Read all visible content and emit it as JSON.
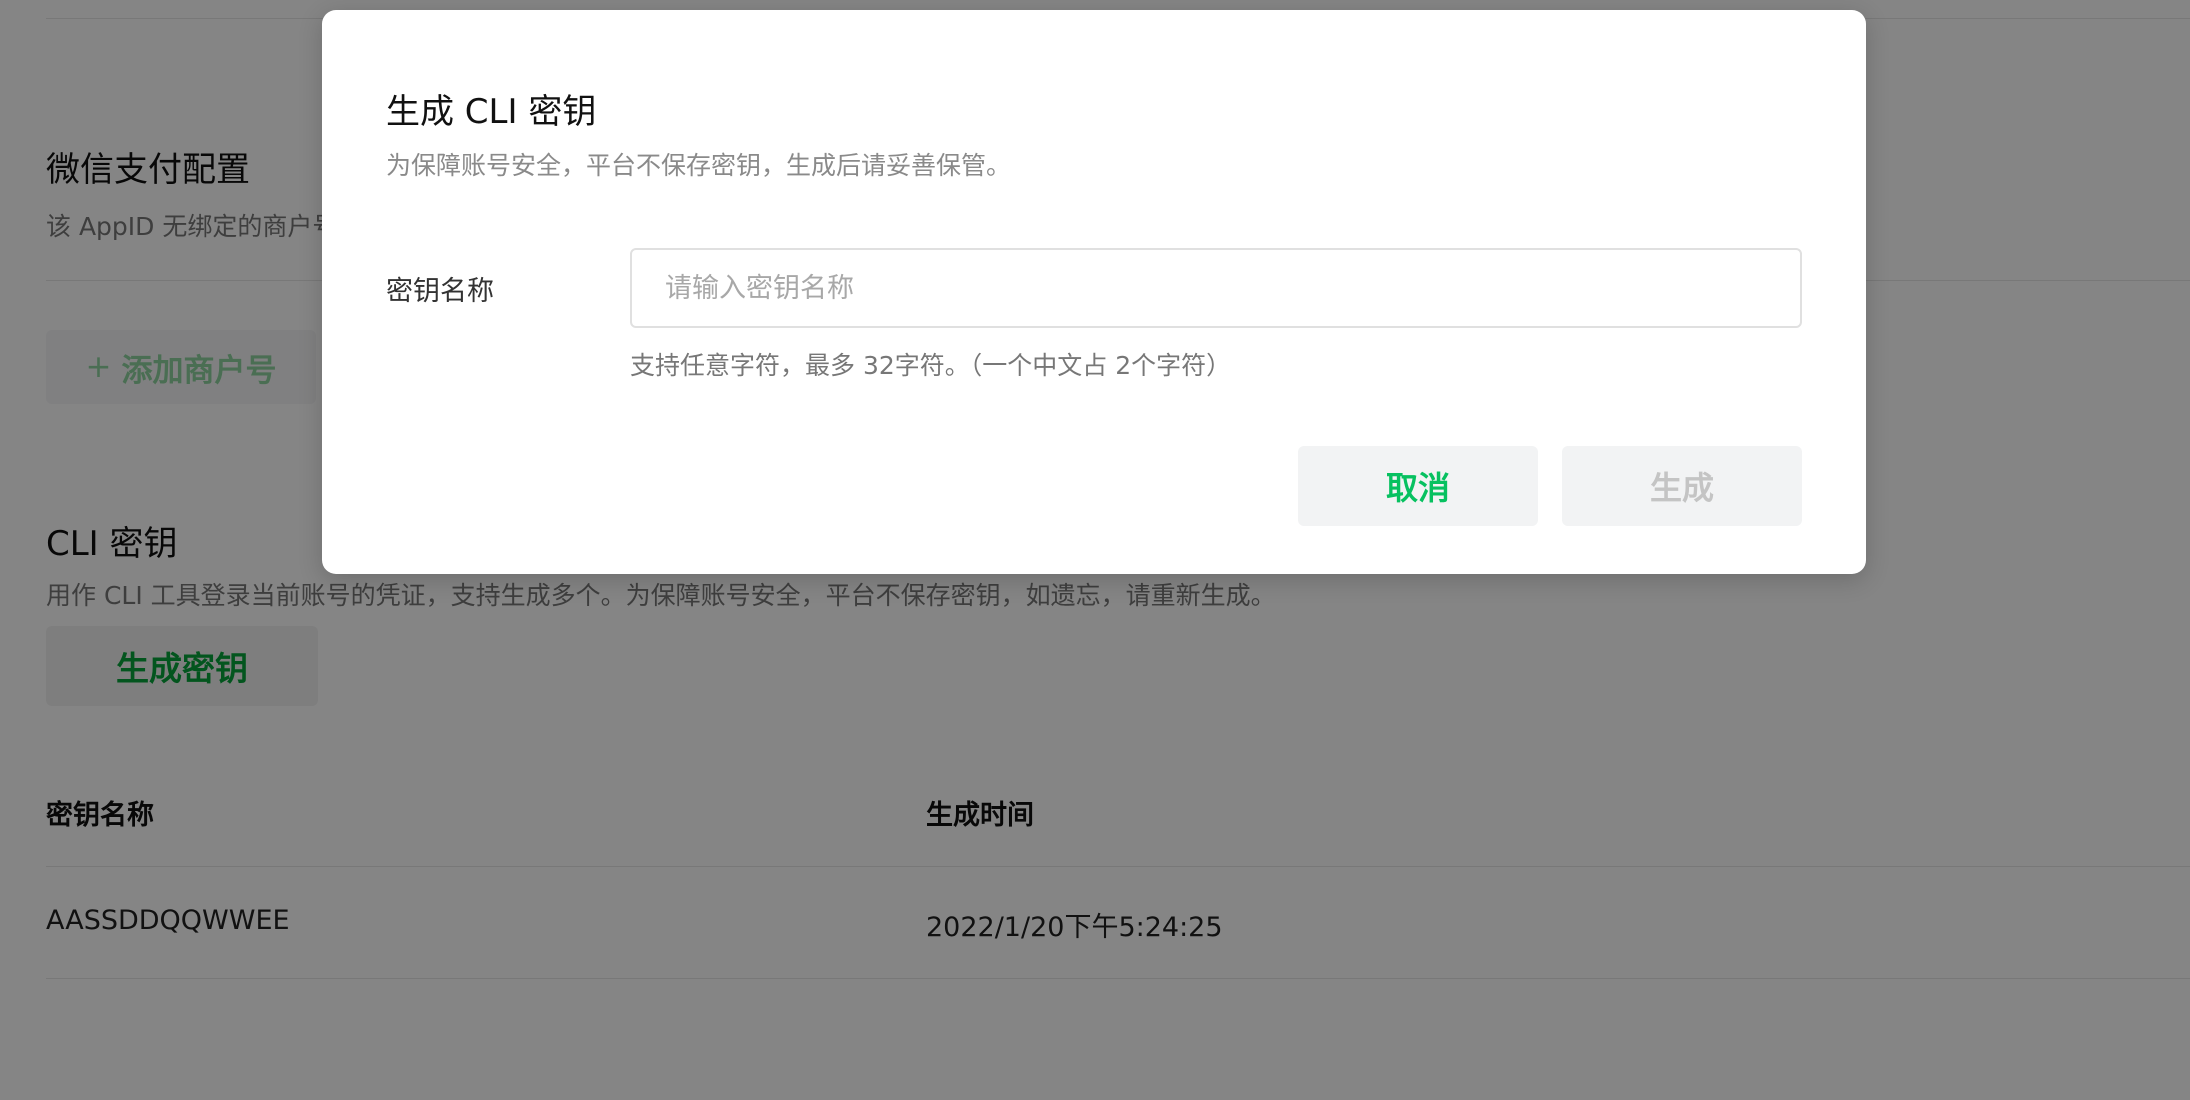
{
  "background_page": {
    "wechat_pay": {
      "title": "微信支付配置",
      "description": "该 AppID 无绑定的商户号",
      "add_button": {
        "icon": "plus-icon",
        "label": "添加商户号"
      }
    },
    "cli_keys": {
      "title": "CLI 密钥",
      "description": "用作 CLI 工具登录当前账号的凭证，支持生成多个。为保障账号安全，平台不保存密钥，如遗忘，请重新生成。",
      "generate_button": "生成密钥",
      "table": {
        "columns": [
          "密钥名称",
          "生成时间"
        ],
        "rows": [
          [
            "AASSDDQQWWEE",
            "2022/1/20下午5:24:25"
          ]
        ]
      }
    }
  },
  "modal": {
    "title": "生成 CLI 密钥",
    "subtitle": "为保障账号安全，平台不保存密钥，生成后请妥善保管。",
    "field_label": "密钥名称",
    "input": {
      "value": "",
      "placeholder": "请输入密钥名称"
    },
    "hint": "支持任意字符，最多 32字符。（一个中文占 2个字符）",
    "cancel_label": "取消",
    "generate_label": "生成"
  },
  "colors": {
    "accent_green": "#07c160",
    "disabled_text": "#c4c4c4",
    "overlay": "rgba(0,0,0,0.48)"
  }
}
